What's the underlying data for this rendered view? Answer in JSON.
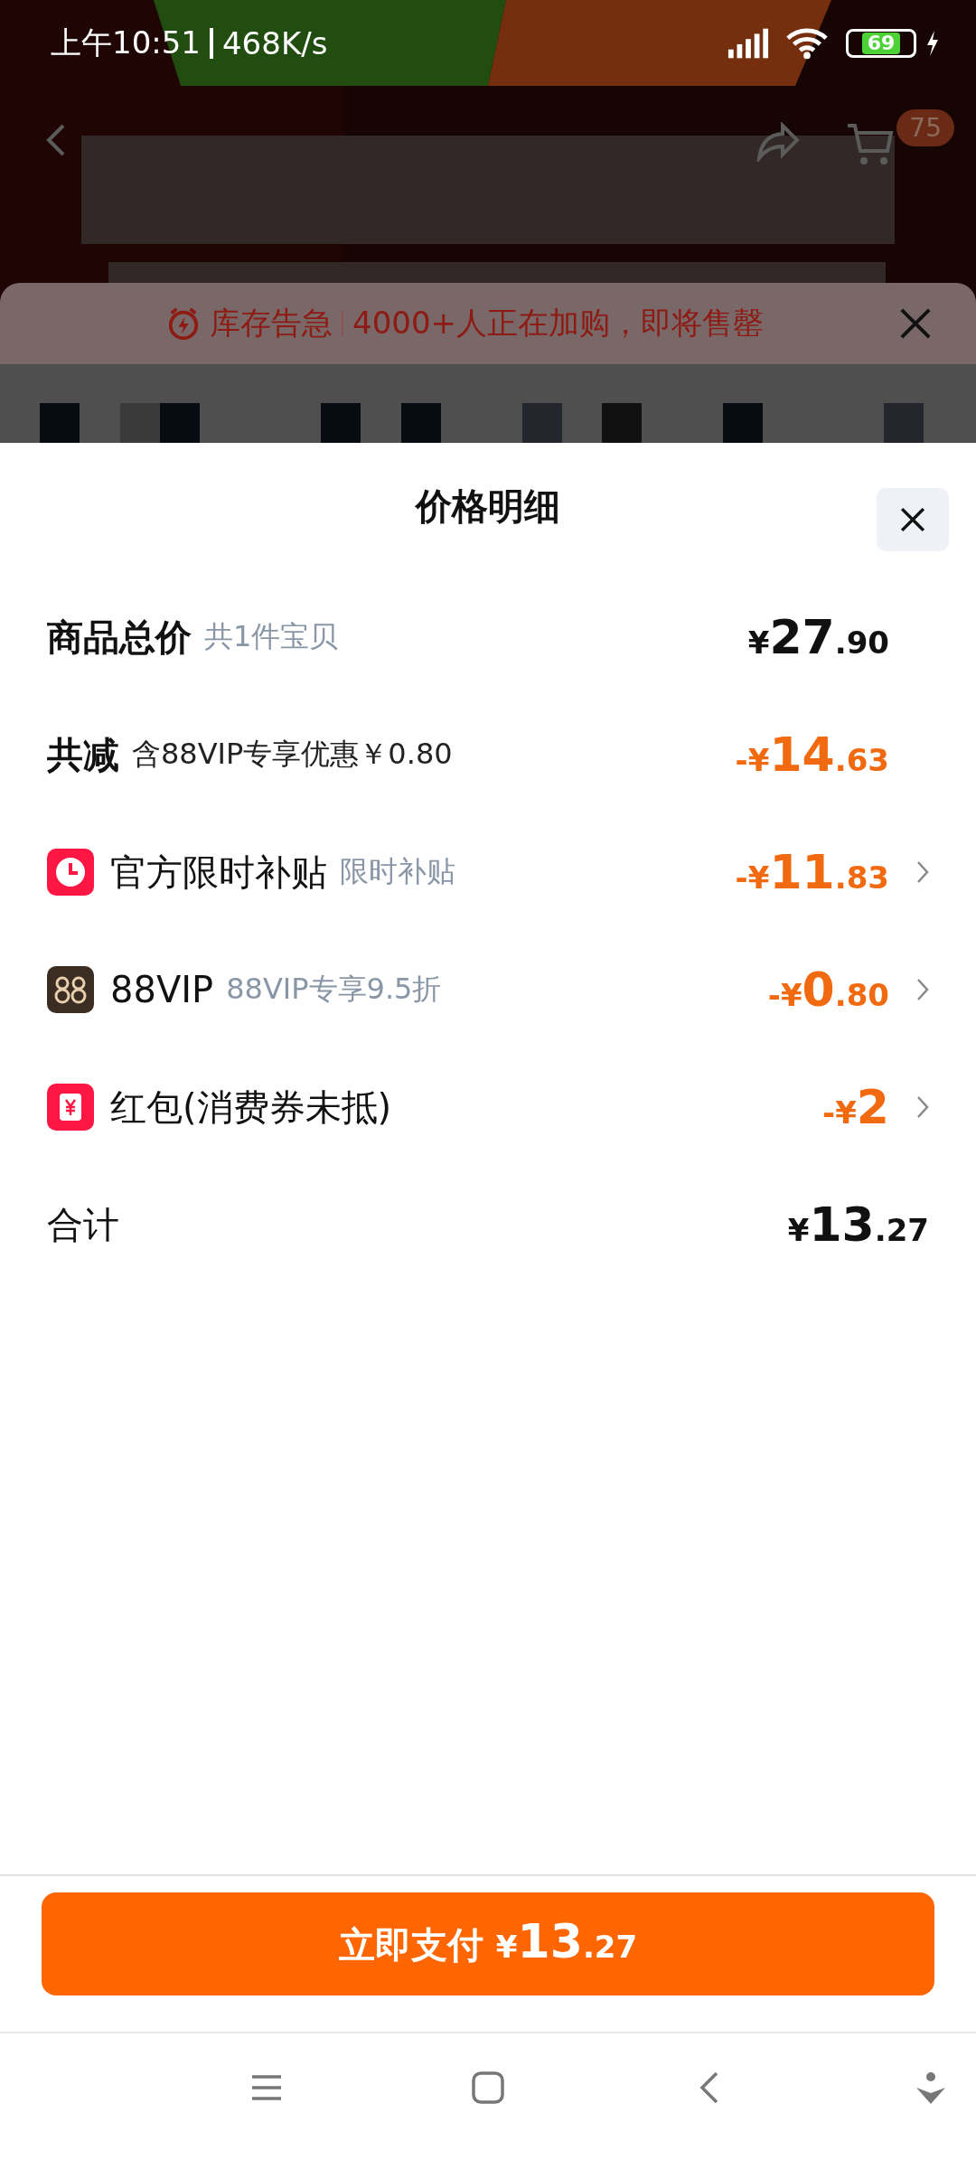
{
  "status_bar": {
    "time": "上午10:51",
    "speed": "468K/s",
    "battery": "69"
  },
  "product_header": {
    "cart_badge": "75"
  },
  "stock_alert": {
    "tag": "库存告急",
    "message": "4000+人正在加购，即将售罄"
  },
  "sheet": {
    "title": "价格明细"
  },
  "rows": [
    {
      "kind": "plain",
      "label": "商品总价",
      "note": "共1件宝贝",
      "note_muted": true,
      "amount": "¥27.90",
      "discount": false,
      "link": false
    },
    {
      "kind": "plain",
      "label": "共减",
      "note": "含88VIP专享优惠￥0.80",
      "note_muted": false,
      "amount": "-¥14.63",
      "discount": true,
      "link": false
    },
    {
      "kind": "clock",
      "label": "官方限时补贴",
      "note": "限时补贴",
      "note_muted": true,
      "amount": "-¥11.83",
      "discount": true,
      "link": true
    },
    {
      "kind": "vip",
      "label": "88VIP",
      "note": "88VIP专享9.5折",
      "note_muted": true,
      "amount": "-¥0.80",
      "discount": true,
      "link": true
    },
    {
      "kind": "redpacket",
      "label": "红包(消费券未抵)",
      "amount": "-¥2",
      "discount": true,
      "link": true
    }
  ],
  "total": {
    "label": "合计",
    "amount": "¥13.27"
  },
  "pay_button": {
    "label": "立即支付",
    "amount": "¥13.27"
  }
}
